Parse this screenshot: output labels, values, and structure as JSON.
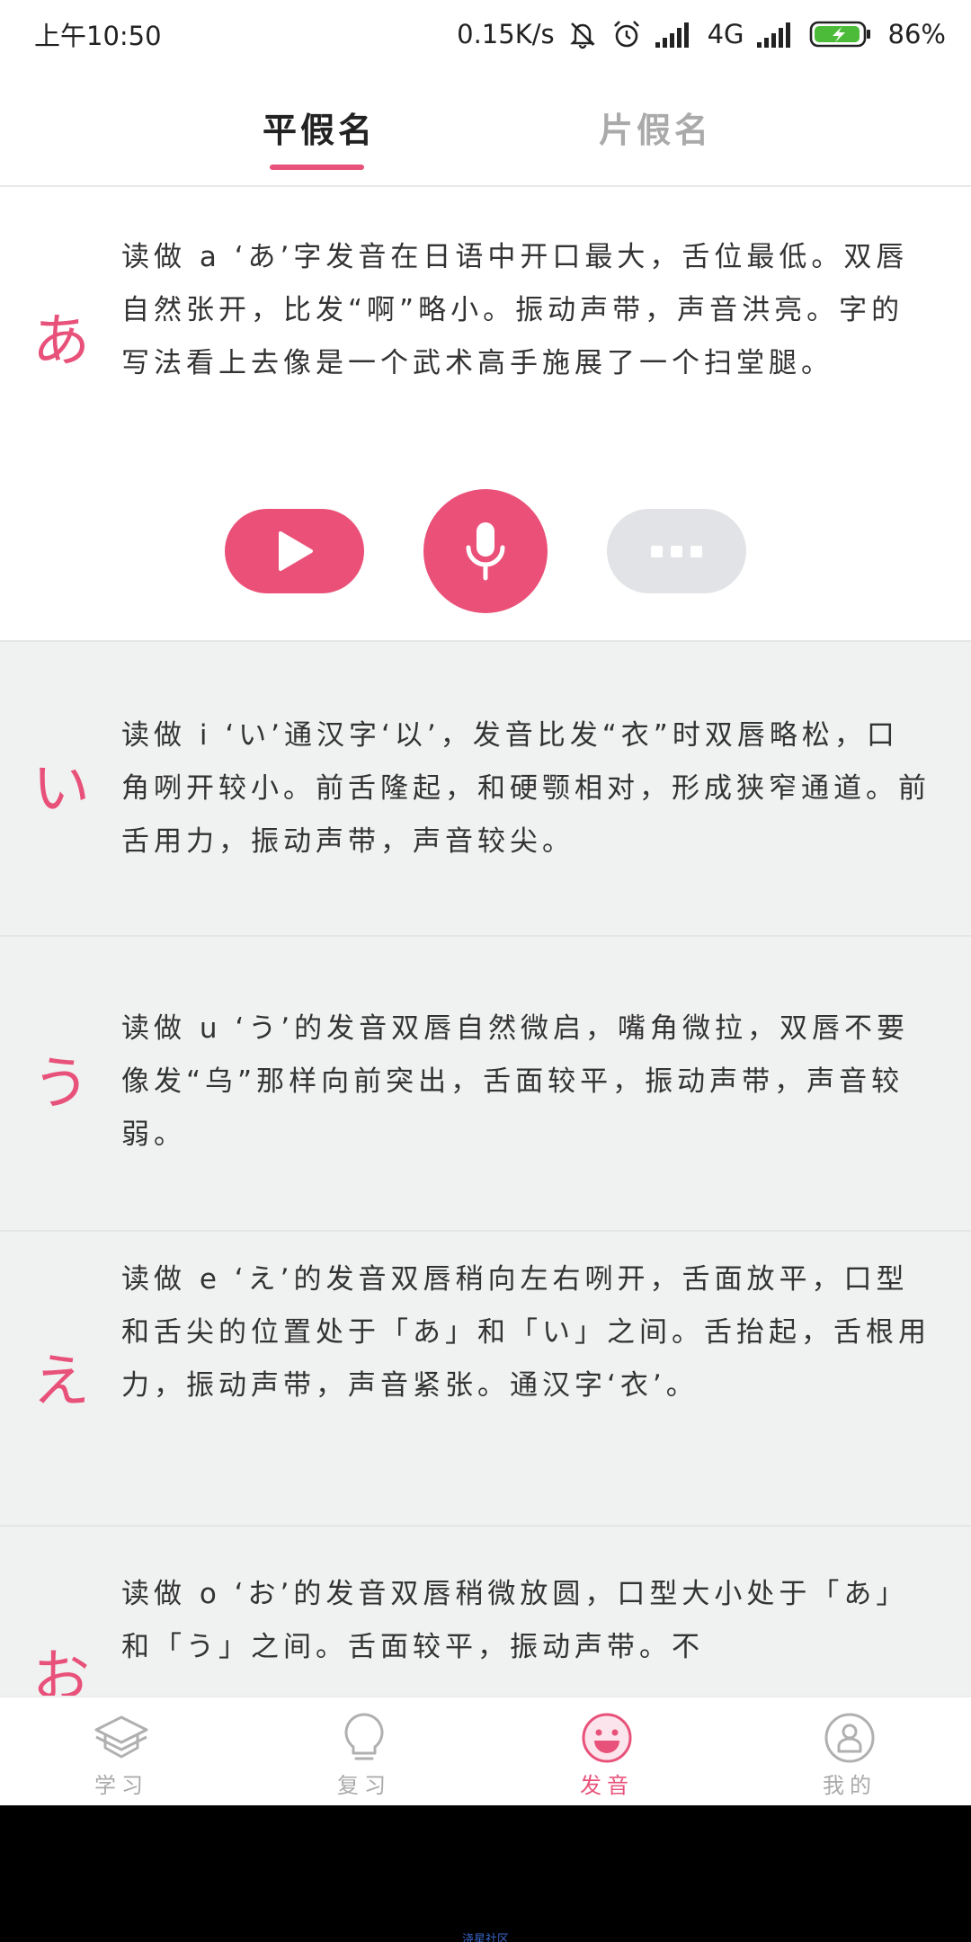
{
  "status_bar": {
    "time": "上午10:50",
    "net_speed": "0.15K/s",
    "network": "4G",
    "battery": "86%"
  },
  "tabs": {
    "active": "平假名",
    "inactive": "片假名"
  },
  "cards": [
    {
      "kana": "あ",
      "text": "读做 a ‘あ’字发音在日语中开口最大，舌位最低。双唇自然张开，比发“啊”略小。振动声带，声音洪亮。字的写法看上去像是一个武术高手施展了一个扫堂腿。"
    },
    {
      "kana": "い",
      "text": "读做 i ‘い’通汉字‘以’，发音比发“衣”时双唇略松，口角咧开较小。前舌隆起，和硬颚相对，形成狭窄通道。前舌用力，振动声带，声音较尖。"
    },
    {
      "kana": "う",
      "text": "读做 u ‘う’的发音双唇自然微启，嘴角微拉，双唇不要像发“乌”那样向前突出，舌面较平，振动声带，声音较弱。"
    },
    {
      "kana": "え",
      "text": "读做 e ‘え’的发音双唇稍向左右咧开，舌面放平，口型和舌尖的位置处于「あ」和「い」之间。舌抬起，舌根用力，振动声带，声音紧张。通汉字‘衣’。"
    },
    {
      "kana": "お",
      "text": "读做 o ‘お’的发音双唇稍微放圆，口型大小处于「あ」和「う」之间。舌面较平，振动声带。不"
    }
  ],
  "nav": [
    {
      "label": "学习",
      "icon": "graduation-cap-icon"
    },
    {
      "label": "复习",
      "icon": "lightbulb-icon"
    },
    {
      "label": "发音",
      "icon": "smile-icon"
    },
    {
      "label": "我的",
      "icon": "user-icon"
    }
  ],
  "watermark": "浇星社区",
  "colors": {
    "accent": "#e8527a",
    "card_gray": "#f0f1f1",
    "muted": "#aaaaaa"
  }
}
